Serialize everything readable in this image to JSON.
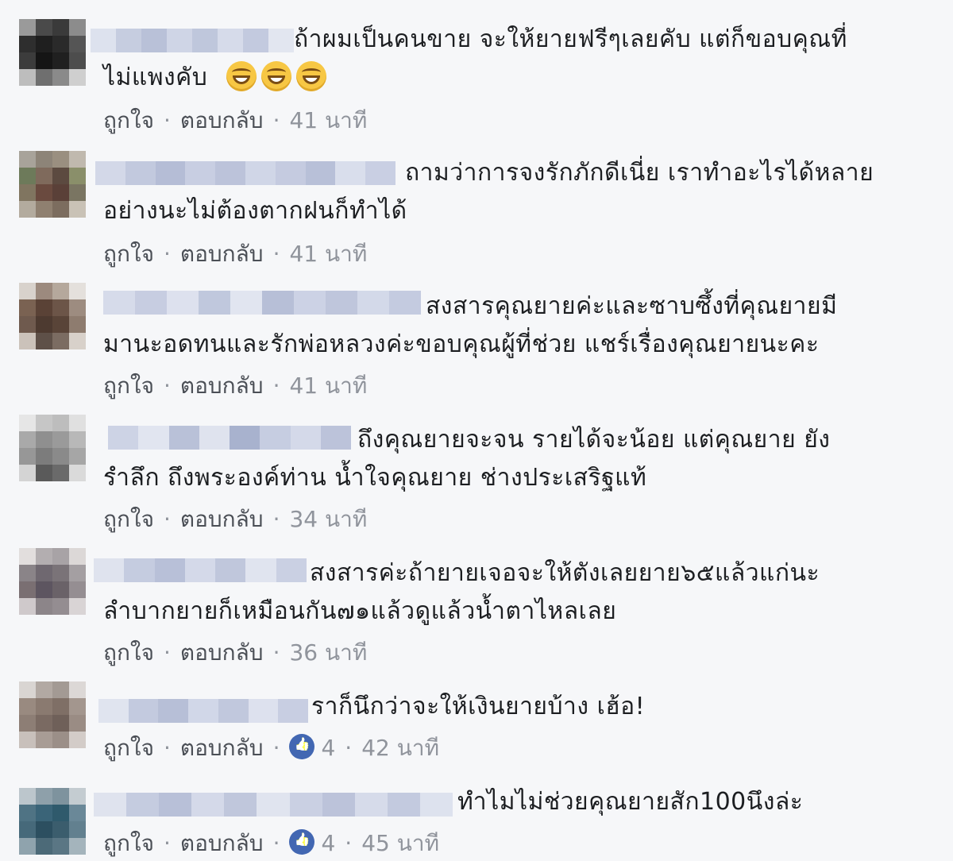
{
  "actions": {
    "like_label": "ถูกใจ",
    "reply_label": "ตอบกลับ",
    "separator": "·"
  },
  "comments": [
    {
      "line1": "ถ้าผมเป็นคนขาย จะให้ยายฟรีๆเลยคับ แต่ก็ขอบคุณที่",
      "line2": "ไม่แพงคับ",
      "emoji": [
        "grinning-face-emoji",
        "grinning-face-emoji",
        "grinning-face-emoji"
      ],
      "time": "41 นาที",
      "likes": null
    },
    {
      "line1": "ถามว่าการจงรักภักดีเนี่ย เราทำอะไรได้หลาย",
      "line2": "อย่างนะไม่ต้องตากฝนก็ทำได้",
      "time": "41 นาที",
      "likes": null
    },
    {
      "line1": "สงสารคุณยายค่ะและซาบซึ้งที่คุณยายมี",
      "line2": "มานะอดทนและรักพ่อหลวงค่ะขอบคุณผู้ที่ช่วย แชร์เรื่องคุณยายนะคะ",
      "time": "41 นาที",
      "likes": null
    },
    {
      "line1": "ถึงคุณยายจะจน รายได้จะน้อย แต่คุณยาย ยัง",
      "line2": "รำลึก ถึงพระองค์ท่าน น้ำใจคุณยาย ช่างประเสริฐแท้",
      "time": "34 นาที",
      "likes": null
    },
    {
      "line1": "สงสารค่ะถ้ายายเจอจะให้ตังเลยยาย๖๕แล้วแก่นะ",
      "line2": "ลำบากยายก็เหมือนกัน๗๑แล้วดูแล้วน้ำตาไหลเลย",
      "time": "36 นาที",
      "likes": null
    },
    {
      "line1": "ราก็นึกว่าจะให้เงินยายบ้าง เฮ้อ!",
      "line2": "",
      "time": "42 นาที",
      "likes": "4"
    },
    {
      "line1": "ทำไมไม่ช่วยคุณยายสัก100นึงล่ะ",
      "line2": "",
      "time": "45 นาที",
      "likes": "4"
    }
  ],
  "colors": {
    "background": "#f6f7f9",
    "text": "#1c1e21",
    "meta": "#90949c",
    "like_badge": "#4267b2"
  }
}
